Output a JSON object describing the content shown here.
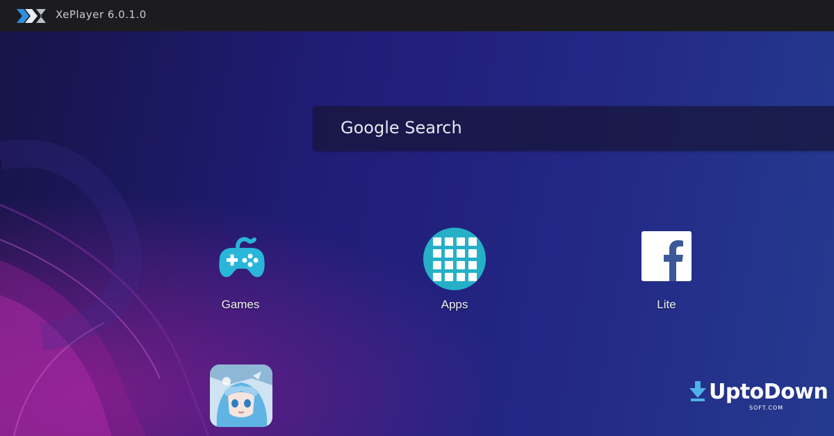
{
  "window": {
    "title": "XePlayer 6.0.1.0",
    "logo_icon": "xeplayer-logo",
    "logo_text": "X"
  },
  "search": {
    "label": "Google Search"
  },
  "apps": [
    {
      "label": "Games",
      "icon": "gamepad-icon",
      "color": "#29b6d8"
    },
    {
      "label": "Apps",
      "icon": "app-drawer-icon",
      "color": "#26b0c8"
    },
    {
      "label": "Lite",
      "icon": "facebook-icon",
      "color": "#3b5998"
    }
  ],
  "game_app": {
    "icon": "anime-game-icon"
  },
  "watermark": {
    "text": "UptoDown",
    "subtext": "SOFT.COM",
    "icon": "download-arrow-icon"
  },
  "colors": {
    "titlebar": "#1c1c1f",
    "desktop": "#1f1c74",
    "accent": "#26b0c8",
    "facebook": "#3b5998"
  }
}
